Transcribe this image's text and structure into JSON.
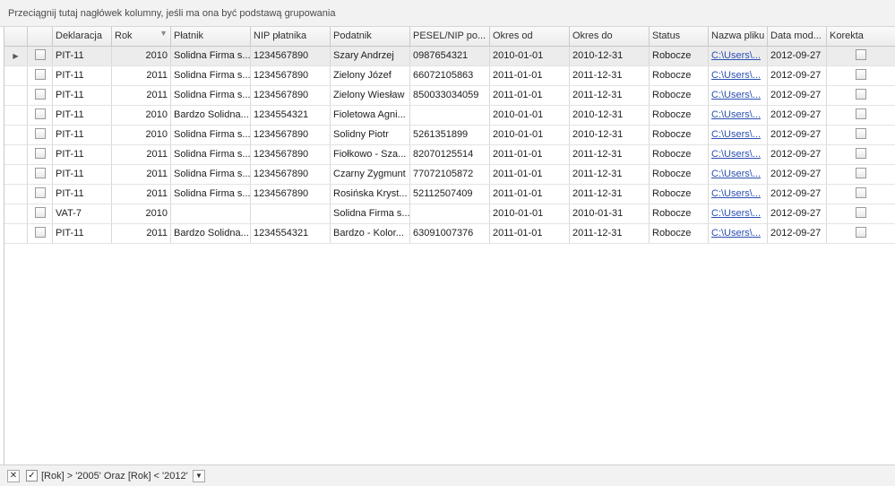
{
  "group_panel": {
    "text": "Przeciągnij tutaj nagłówek kolumny, jeśli ma ona być podstawą grupowania"
  },
  "columns": {
    "deklaracja": "Deklaracja",
    "rok": "Rok",
    "platnik": "Płatnik",
    "nip_platnika": "NIP płatnika",
    "podatnik": "Podatnik",
    "pesel": "PESEL/NIP po...",
    "okres_od": "Okres od",
    "okres_do": "Okres do",
    "status": "Status",
    "nazwa_pliku": "Nazwa pliku",
    "data_mod": "Data mod...",
    "korekta": "Korekta"
  },
  "rows": [
    {
      "deklaracja": "PIT-11",
      "rok": "2010",
      "platnik": "Solidna Firma s...",
      "nip": "1234567890",
      "podatnik": "Szary Andrzej",
      "pesel": "0987654321",
      "od": "2010-01-01",
      "do": "2010-12-31",
      "status": "Robocze",
      "plik": "C:\\Users\\...",
      "data": "2012-09-27"
    },
    {
      "deklaracja": "PIT-11",
      "rok": "2011",
      "platnik": "Solidna Firma s...",
      "nip": "1234567890",
      "podatnik": "Zielony Józef",
      "pesel": "66072105863",
      "od": "2011-01-01",
      "do": "2011-12-31",
      "status": "Robocze",
      "plik": "C:\\Users\\...",
      "data": "2012-09-27"
    },
    {
      "deklaracja": "PIT-11",
      "rok": "2011",
      "platnik": "Solidna Firma s...",
      "nip": "1234567890",
      "podatnik": "Zielony Wiesław",
      "pesel": "850033034059",
      "od": "2011-01-01",
      "do": "2011-12-31",
      "status": "Robocze",
      "plik": "C:\\Users\\...",
      "data": "2012-09-27"
    },
    {
      "deklaracja": "PIT-11",
      "rok": "2010",
      "platnik": "Bardzo Solidna...",
      "nip": "1234554321",
      "podatnik": "Fioletowa Agni...",
      "pesel": "",
      "od": "2010-01-01",
      "do": "2010-12-31",
      "status": "Robocze",
      "plik": "C:\\Users\\...",
      "data": "2012-09-27"
    },
    {
      "deklaracja": "PIT-11",
      "rok": "2010",
      "platnik": "Solidna Firma s...",
      "nip": "1234567890",
      "podatnik": "Solidny Piotr",
      "pesel": "5261351899",
      "od": "2010-01-01",
      "do": "2010-12-31",
      "status": "Robocze",
      "plik": "C:\\Users\\...",
      "data": "2012-09-27"
    },
    {
      "deklaracja": "PIT-11",
      "rok": "2011",
      "platnik": "Solidna Firma s...",
      "nip": "1234567890",
      "podatnik": "Fiołkowo - Sza...",
      "pesel": "82070125514",
      "od": "2011-01-01",
      "do": "2011-12-31",
      "status": "Robocze",
      "plik": "C:\\Users\\...",
      "data": "2012-09-27"
    },
    {
      "deklaracja": "PIT-11",
      "rok": "2011",
      "platnik": "Solidna Firma s...",
      "nip": "1234567890",
      "podatnik": "Czarny Zygmunt",
      "pesel": "77072105872",
      "od": "2011-01-01",
      "do": "2011-12-31",
      "status": "Robocze",
      "plik": "C:\\Users\\...",
      "data": "2012-09-27"
    },
    {
      "deklaracja": "PIT-11",
      "rok": "2011",
      "platnik": "Solidna Firma s...",
      "nip": "1234567890",
      "podatnik": "Rosińska Kryst...",
      "pesel": "52112507409",
      "od": "2011-01-01",
      "do": "2011-12-31",
      "status": "Robocze",
      "plik": "C:\\Users\\...",
      "data": "2012-09-27"
    },
    {
      "deklaracja": "VAT-7",
      "rok": "2010",
      "platnik": "",
      "nip": "",
      "podatnik": "Solidna Firma s...",
      "pesel": "",
      "od": "2010-01-01",
      "do": "2010-01-31",
      "status": "Robocze",
      "plik": "C:\\Users\\...",
      "data": "2012-09-27"
    },
    {
      "deklaracja": "PIT-11",
      "rok": "2011",
      "platnik": "Bardzo Solidna...",
      "nip": "1234554321",
      "podatnik": "Bardzo - Kolor...",
      "pesel": "63091007376",
      "od": "2011-01-01",
      "do": "2011-12-31",
      "status": "Robocze",
      "plik": "C:\\Users\\...",
      "data": "2012-09-27"
    }
  ],
  "filter": {
    "text": "[Rok] > '2005' Oraz [Rok] < '2012'"
  },
  "icons": {
    "row_indicator": "row-indicator-arrow-icon",
    "filter": "filter-funnel-icon"
  }
}
